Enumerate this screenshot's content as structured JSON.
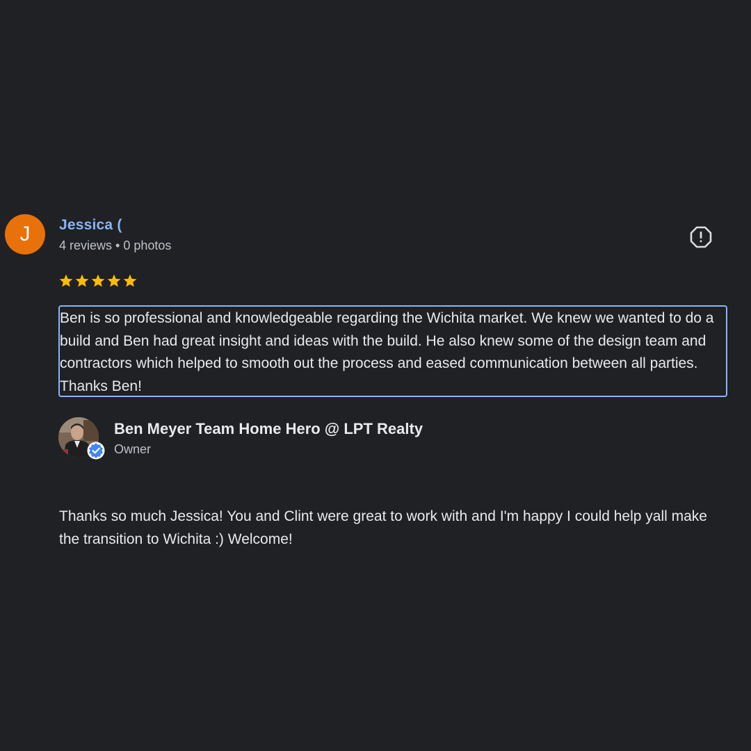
{
  "review": {
    "reviewer": {
      "initial": "J",
      "name": "Jessica (",
      "meta": "4 reviews • 0 photos",
      "avatar_color": "#e8710a"
    },
    "rating": 5,
    "star_color": "#fbbc04",
    "report_icon": "report-flag-icon",
    "text": "Ben is so professional and knowledgeable regarding the Wichita market. We knew we wanted to do a build and Ben had great insight and ideas with the build. He also knew some of the design team and contractors which helped to smooth out the process and eased communication between all parties. Thanks Ben!"
  },
  "owner_response": {
    "name": "Ben Meyer Team Home Hero @ LPT Realty",
    "role": "Owner",
    "badge_icon": "verified-check-icon",
    "badge_color": "#4285f4",
    "text": "Thanks so much Jessica! You and Clint were great to work with and I'm happy I could help yall make the transition to Wichita :) Welcome!"
  },
  "colors": {
    "background": "#202124",
    "link": "#8ab4f8",
    "text": "#e8eaed",
    "secondary_text": "#bdc1c6"
  }
}
